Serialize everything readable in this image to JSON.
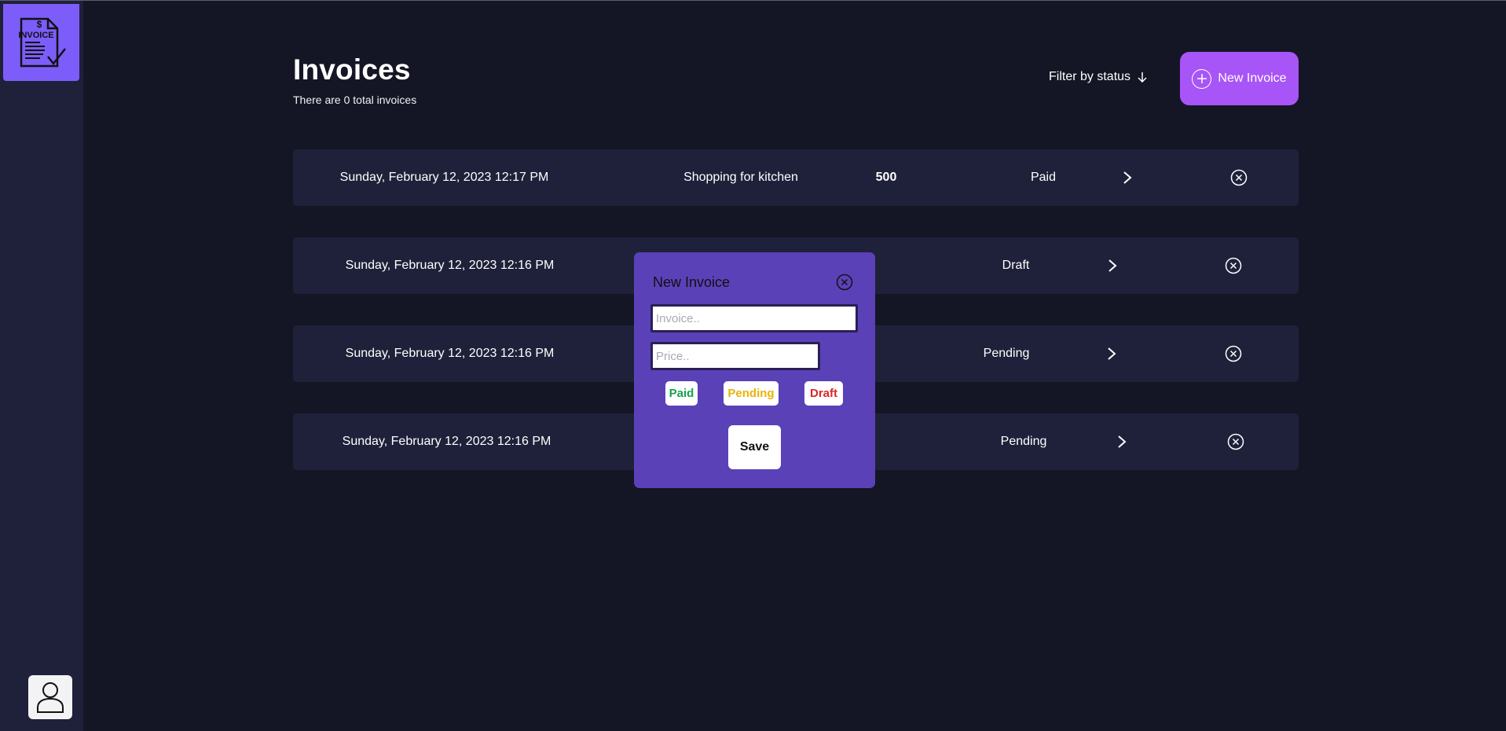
{
  "sidebar": {
    "logo_text": "INVOICE",
    "logo_symbol": "$",
    "logo_icon": "invoice-logo-icon",
    "avatar_icon": "user-icon"
  },
  "header": {
    "title": "Invoices",
    "subtitle": "There are 0 total invoices",
    "filter_label": "Filter by status",
    "new_button_label": "New Invoice"
  },
  "invoices": [
    {
      "date": "Sunday, February 12, 2023 12:17 PM",
      "description": "Shopping for kitchen",
      "amount": "500",
      "status": "Paid"
    },
    {
      "date": "Sunday, February 12, 2023 12:16 PM",
      "description": "",
      "amount": "",
      "status": "Draft"
    },
    {
      "date": "Sunday, February 12, 2023 12:16 PM",
      "description": "",
      "amount": "",
      "status": "Pending"
    },
    {
      "date": "Sunday, February 12, 2023 12:16 PM",
      "description": "",
      "amount": "",
      "status": "Pending"
    }
  ],
  "modal": {
    "title": "New Invoice",
    "invoice_placeholder": "Invoice..",
    "price_placeholder": "Price..",
    "status_options": [
      "Paid",
      "Pending",
      "Draft"
    ],
    "save_label": "Save"
  },
  "colors": {
    "background": "#141625",
    "sidebar": "#1e2139",
    "accent": "#7c5dfa",
    "button": "#a855f7",
    "modal": "#5b41b8",
    "paid": "#16a34a",
    "pending": "#eab308",
    "draft": "#dc2626"
  }
}
